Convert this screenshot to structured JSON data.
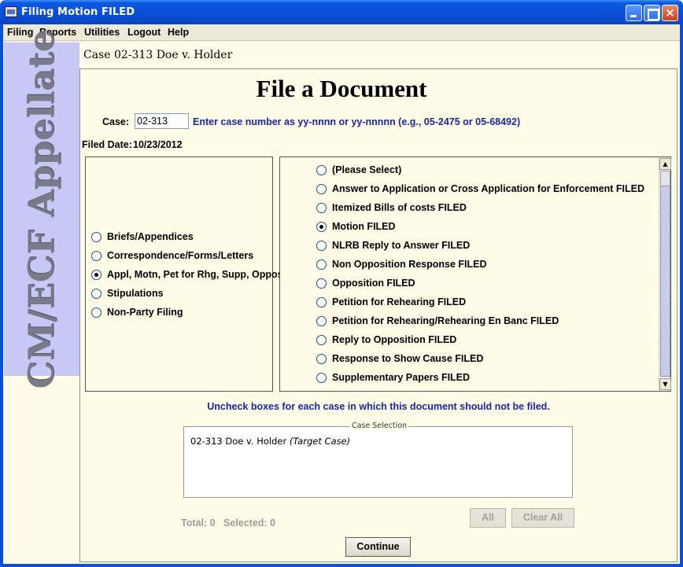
{
  "window": {
    "title": "Filing Motion FILED",
    "minimize_glyph": "_",
    "maximize_glyph": "□",
    "close_glyph": "×"
  },
  "menubar": [
    "Filing",
    "Reports",
    "Utilities",
    "Logout",
    "Help"
  ],
  "banner": {
    "text": "CM/ECF Appellate"
  },
  "case_header": "Case 02-313 Doe v. Holder",
  "page_title": "File a Document",
  "case_field": {
    "label": "Case:",
    "value": "02-313",
    "hint": "Enter case number as yy-nnnn or yy-nnnnn (e.g., 05-2475 or 05-68492)"
  },
  "filed_date": {
    "label": "Filed Date:",
    "value": "10/23/2012"
  },
  "categories": [
    {
      "label": "Briefs/Appendices",
      "selected": false
    },
    {
      "label": "Correspondence/Forms/Letters",
      "selected": false
    },
    {
      "label": "Appl, Motn, Pet for Rhg, Supp, Oppos",
      "selected": true
    },
    {
      "label": "Stipulations",
      "selected": false
    },
    {
      "label": "Non-Party Filing",
      "selected": false
    }
  ],
  "document_types": [
    {
      "label": "(Please Select)",
      "selected": false
    },
    {
      "label": "Answer to Application or Cross Application for Enforcement FILED",
      "selected": false
    },
    {
      "label": "Itemized Bills of costs FILED",
      "selected": false
    },
    {
      "label": "Motion FILED",
      "selected": true
    },
    {
      "label": "NLRB Reply to Answer FILED",
      "selected": false
    },
    {
      "label": "Non Opposition Response FILED",
      "selected": false
    },
    {
      "label": "Opposition FILED",
      "selected": false
    },
    {
      "label": "Petition for Rehearing FILED",
      "selected": false
    },
    {
      "label": "Petition for Rehearing/Rehearing En Banc FILED",
      "selected": false
    },
    {
      "label": "Reply to Opposition FILED",
      "selected": false
    },
    {
      "label": "Response to Show Cause FILED",
      "selected": false
    },
    {
      "label": "Supplementary Papers FILED",
      "selected": false
    }
  ],
  "instruction": "Uncheck boxes for each case in which this document should not be filed.",
  "case_selection": {
    "legend": "Case Selection",
    "entry": {
      "case": "02-313 Doe v. Holder",
      "note": "(Target Case)"
    }
  },
  "totals": {
    "total": "Total: 0",
    "selected": "Selected: 0"
  },
  "buttons": {
    "all": "All",
    "clear_all": "Clear All",
    "continue": "Continue"
  },
  "colors": {
    "titlebar": "#0a4fd4",
    "hint_text": "#1a24a8",
    "banner_bg": "#c7c8f5",
    "panel_bg": "#fffde8"
  }
}
